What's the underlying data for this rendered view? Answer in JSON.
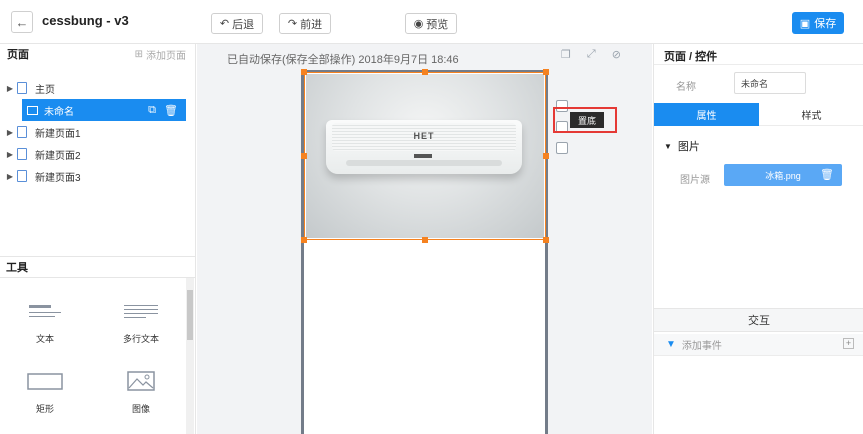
{
  "header": {
    "title": "cessbung - v3",
    "undo_label": "后退",
    "redo_label": "前进",
    "preview_label": "预览",
    "save_label": "保存"
  },
  "left": {
    "pages_title": "页面",
    "add_page": "添加页面",
    "pages": [
      {
        "label": "主页"
      },
      {
        "label": "未命名"
      },
      {
        "label": "新建页面1"
      },
      {
        "label": "新建页面2"
      },
      {
        "label": "新建页面3"
      }
    ],
    "tools_title": "工具",
    "tools": [
      {
        "label": "文本"
      },
      {
        "label": "多行文本"
      },
      {
        "label": "矩形"
      },
      {
        "label": "图像"
      }
    ]
  },
  "canvas": {
    "autosave": "已自动保存(保存全部操作) 2018年9月7日 18:46",
    "image_logo": "HET",
    "tooltip": "置底"
  },
  "right": {
    "title": "页面 / 控件",
    "name_label": "名称",
    "name_value": "未命名",
    "tabs": [
      {
        "label": "属性"
      },
      {
        "label": "样式"
      }
    ],
    "section": "图片",
    "src_label": "图片源",
    "src_value": "冰箱.png",
    "interaction_title": "交互",
    "add_event": "添加事件"
  },
  "colors": {
    "accent": "#1a8cf0",
    "selection": "#f58220",
    "highlight": "#e53935"
  }
}
